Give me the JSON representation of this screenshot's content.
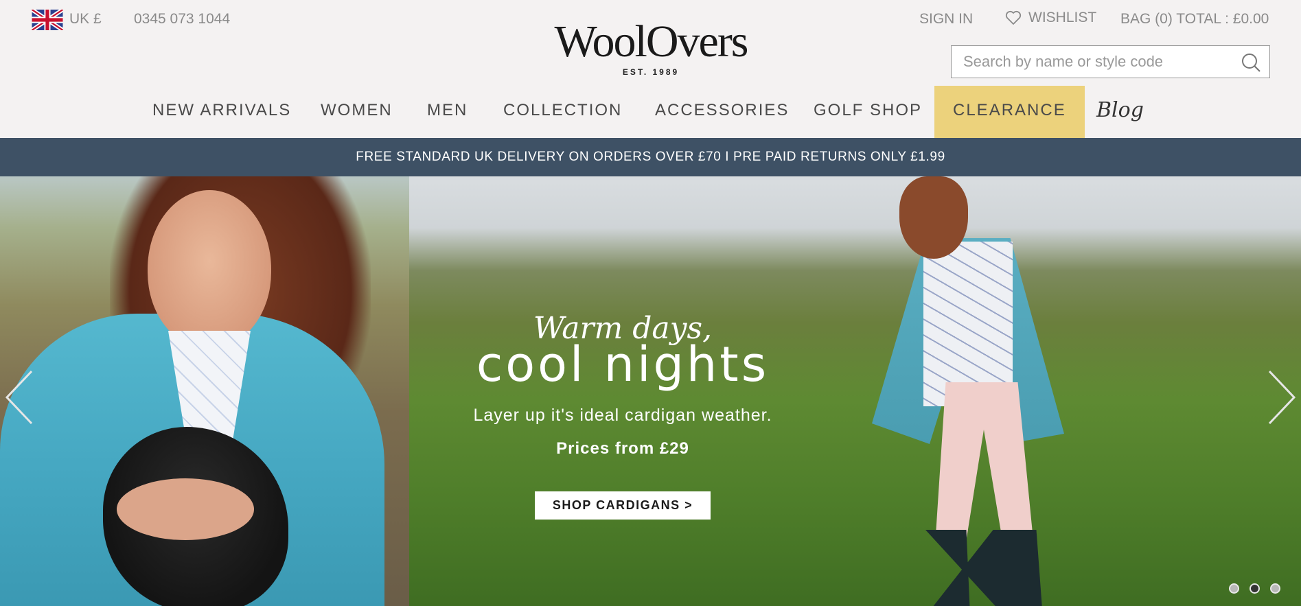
{
  "header": {
    "region": "UK £",
    "phone": "0345 073 1044",
    "logo": "WoolOvers",
    "logo_tagline": "EST. 1989",
    "sign_in": "SIGN IN",
    "wishlist": "WISHLIST",
    "bag": "BAG (0) TOTAL : £0.00",
    "search": {
      "placeholder": "Search by name or style code"
    },
    "icons": {
      "flag": "uk-flag-icon",
      "wishlist": "heart-icon",
      "search": "search-icon"
    }
  },
  "nav": {
    "items": [
      {
        "label": "NEW ARRIVALS"
      },
      {
        "label": "WOMEN"
      },
      {
        "label": "MEN"
      },
      {
        "label": "COLLECTION"
      },
      {
        "label": "ACCESSORIES"
      },
      {
        "label": "GOLF SHOP"
      },
      {
        "label": "CLEARANCE",
        "highlight": "#ecd27c"
      },
      {
        "label": "Blog"
      }
    ]
  },
  "promo": {
    "text": "FREE STANDARD UK DELIVERY ON ORDERS OVER £70 I PRE PAID RETURNS ONLY £1.99",
    "background": "#3e5165"
  },
  "hero": {
    "script_line": "Warm days,",
    "headline": "cool nights",
    "subline": "Layer up it's ideal cardigan weather.",
    "price": "Prices from £29",
    "cta": "SHOP CARDIGANS >",
    "slides_total": 3,
    "active_slide": 2
  }
}
